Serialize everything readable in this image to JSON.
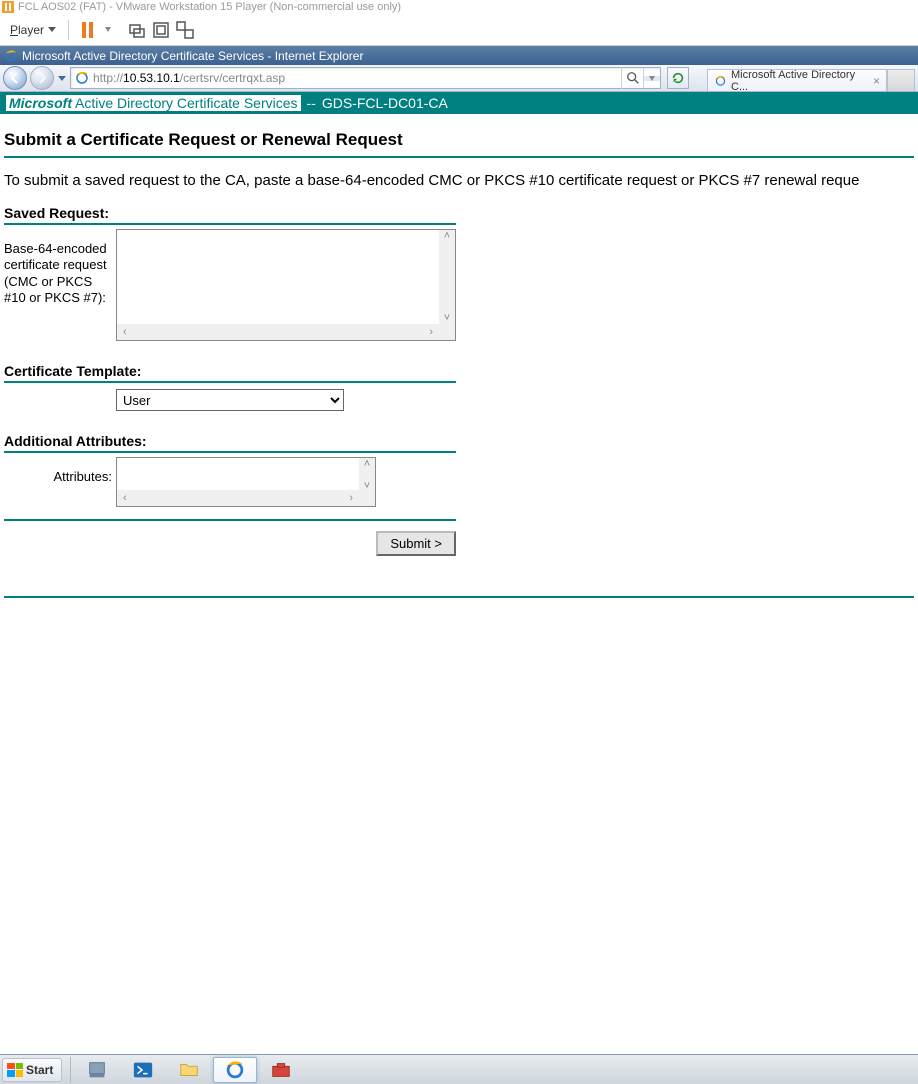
{
  "vmware": {
    "title": "FCL AOS02 (FAT) - VMware Workstation 15 Player (Non-commercial use only)",
    "player_menu": "Player"
  },
  "ie_window": {
    "title": "Microsoft Active Directory Certificate Services - Internet Explorer",
    "url_prefix": "http://",
    "url_host": "10.53.10.1",
    "url_path": "/certsrv/certrqxt.asp",
    "tab_label": "Microsoft Active Directory C..."
  },
  "page": {
    "brand_word": "Microsoft",
    "brand_rest": " Active Directory Certificate Services",
    "ca_sep": "--",
    "ca_name": "GDS-FCL-DC01-CA",
    "heading": "Submit a Certificate Request or Renewal Request",
    "instruction": "To submit a saved request to the CA, paste a base-64-encoded CMC or PKCS #10 certificate request or PKCS #7 renewal reque",
    "saved_request_hdr": "Saved Request:",
    "saved_request_label": "Base-64-encoded certificate request (CMC or PKCS #10 or PKCS #7):",
    "cert_template_hdr": "Certificate Template:",
    "cert_template_value": "User",
    "addl_attr_hdr": "Additional Attributes:",
    "attributes_label": "Attributes:",
    "submit_label": "Submit >"
  },
  "taskbar": {
    "start": "Start"
  }
}
